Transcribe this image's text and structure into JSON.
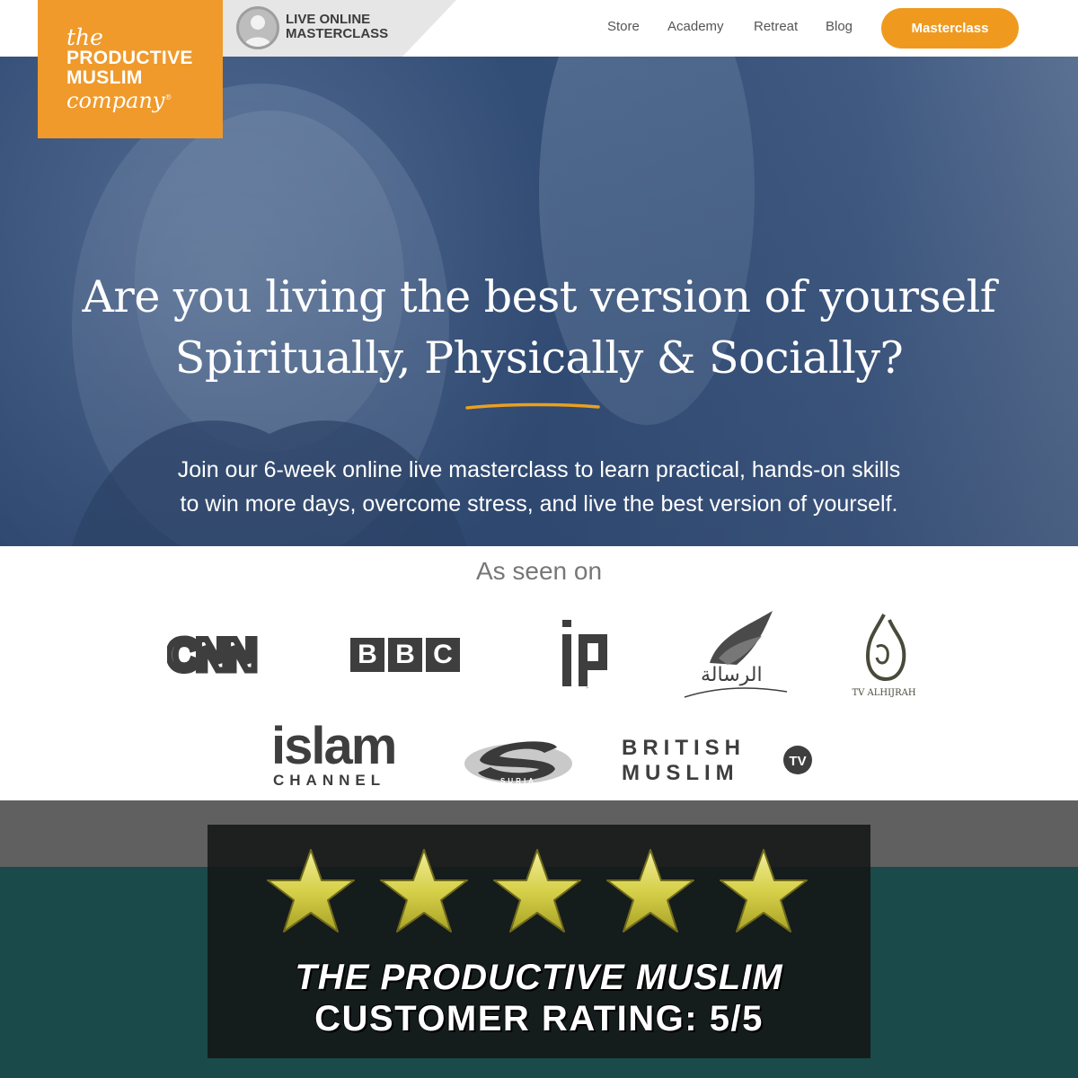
{
  "logo": {
    "line1": "the",
    "line2": "PRODUCTIVE",
    "line3": "MUSLIM",
    "line4": "company",
    "reg": "®"
  },
  "live_tab": {
    "line1": "LIVE ONLINE",
    "line2": "MASTERCLASS",
    "icon": "user-avatar-icon"
  },
  "nav": {
    "items": [
      "Store",
      "Academy",
      "Retreat",
      "Blog"
    ],
    "cta": "Masterclass"
  },
  "hero": {
    "headline_line1": "Are you living the best version of yourself",
    "headline_line2": "Spiritually, Physically & Socially?",
    "sub_line1": "Join our 6-week online live masterclass to learn practical, hands-on skills",
    "sub_line2": "to win more days, overcome stress, and live the best version of yourself."
  },
  "seen_on": {
    "title": "As seen on",
    "logos": {
      "cnn": "CNN",
      "bbc": [
        "B",
        "B",
        "C"
      ],
      "iqraa": "اقرأ",
      "resalah": "الرسالة",
      "alhijrah": "TV ALHIJRAH",
      "islam_channel_top": "islam",
      "islam_channel_bottom": "CHANNEL",
      "suria": "SURIA",
      "british_muslim_line1": "BRITISH",
      "british_muslim_line2": "MUSLIM",
      "british_muslim_badge": "TV"
    }
  },
  "rating": {
    "stars": 5,
    "max": 5,
    "line1": "THE PRODUCTIVE MUSLIM",
    "line2": "CUSTOMER RATING: 5/5"
  },
  "colors": {
    "brand_orange": "#ef9a2b",
    "hero_blue": "#34507a",
    "band_green": "#1a4a49",
    "star_gold": "#d6d04a"
  }
}
